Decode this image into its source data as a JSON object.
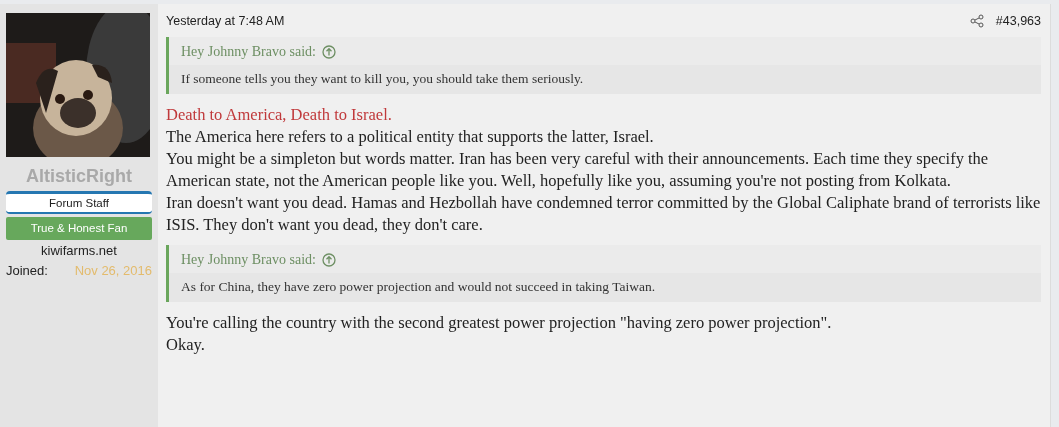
{
  "author": {
    "name": "AltisticRight",
    "banners": [
      {
        "kind": "staff",
        "text": "Forum Staff"
      },
      {
        "kind": "fan",
        "text": "True & Honest Fan"
      }
    ],
    "title": "kiwifarms.net",
    "joined": {
      "label": "Joined:",
      "value": "Nov 26, 2016"
    }
  },
  "post": {
    "date": "Yesterday at 7:48 AM",
    "number": "#43,963",
    "blocks": [
      {
        "kind": "quote",
        "author": "Hey Johnny Bravo said:",
        "text": "If someone tells you they want to kill you, you should take them seriously."
      },
      {
        "kind": "line",
        "highlight": true,
        "text": "Death to America, Death to Israel."
      },
      {
        "kind": "line",
        "highlight": false,
        "text": "The America here refers to a political entity that supports the latter, Israel."
      },
      {
        "kind": "line",
        "highlight": false,
        "text": "You might be a simpleton but words matter. Iran has been very careful with their announcements. Each time they specify the American state, not the American people like you. Well, hopefully like you, assuming you're not posting from Kolkata."
      },
      {
        "kind": "line",
        "highlight": false,
        "text": "Iran doesn't want you dead. Hamas and Hezbollah have condemned terror committed by the Global Caliphate brand of terrorists like ISIS. They don't want you dead, they don't care."
      },
      {
        "kind": "quote",
        "author": "Hey Johnny Bravo said:",
        "text": "As for China, they have zero power projection and would not succeed in taking Taiwan."
      },
      {
        "kind": "line",
        "highlight": false,
        "text": "You're calling the country with the second greatest power projection \"having zero power projection\"."
      },
      {
        "kind": "line",
        "highlight": false,
        "text": "Okay."
      }
    ]
  }
}
